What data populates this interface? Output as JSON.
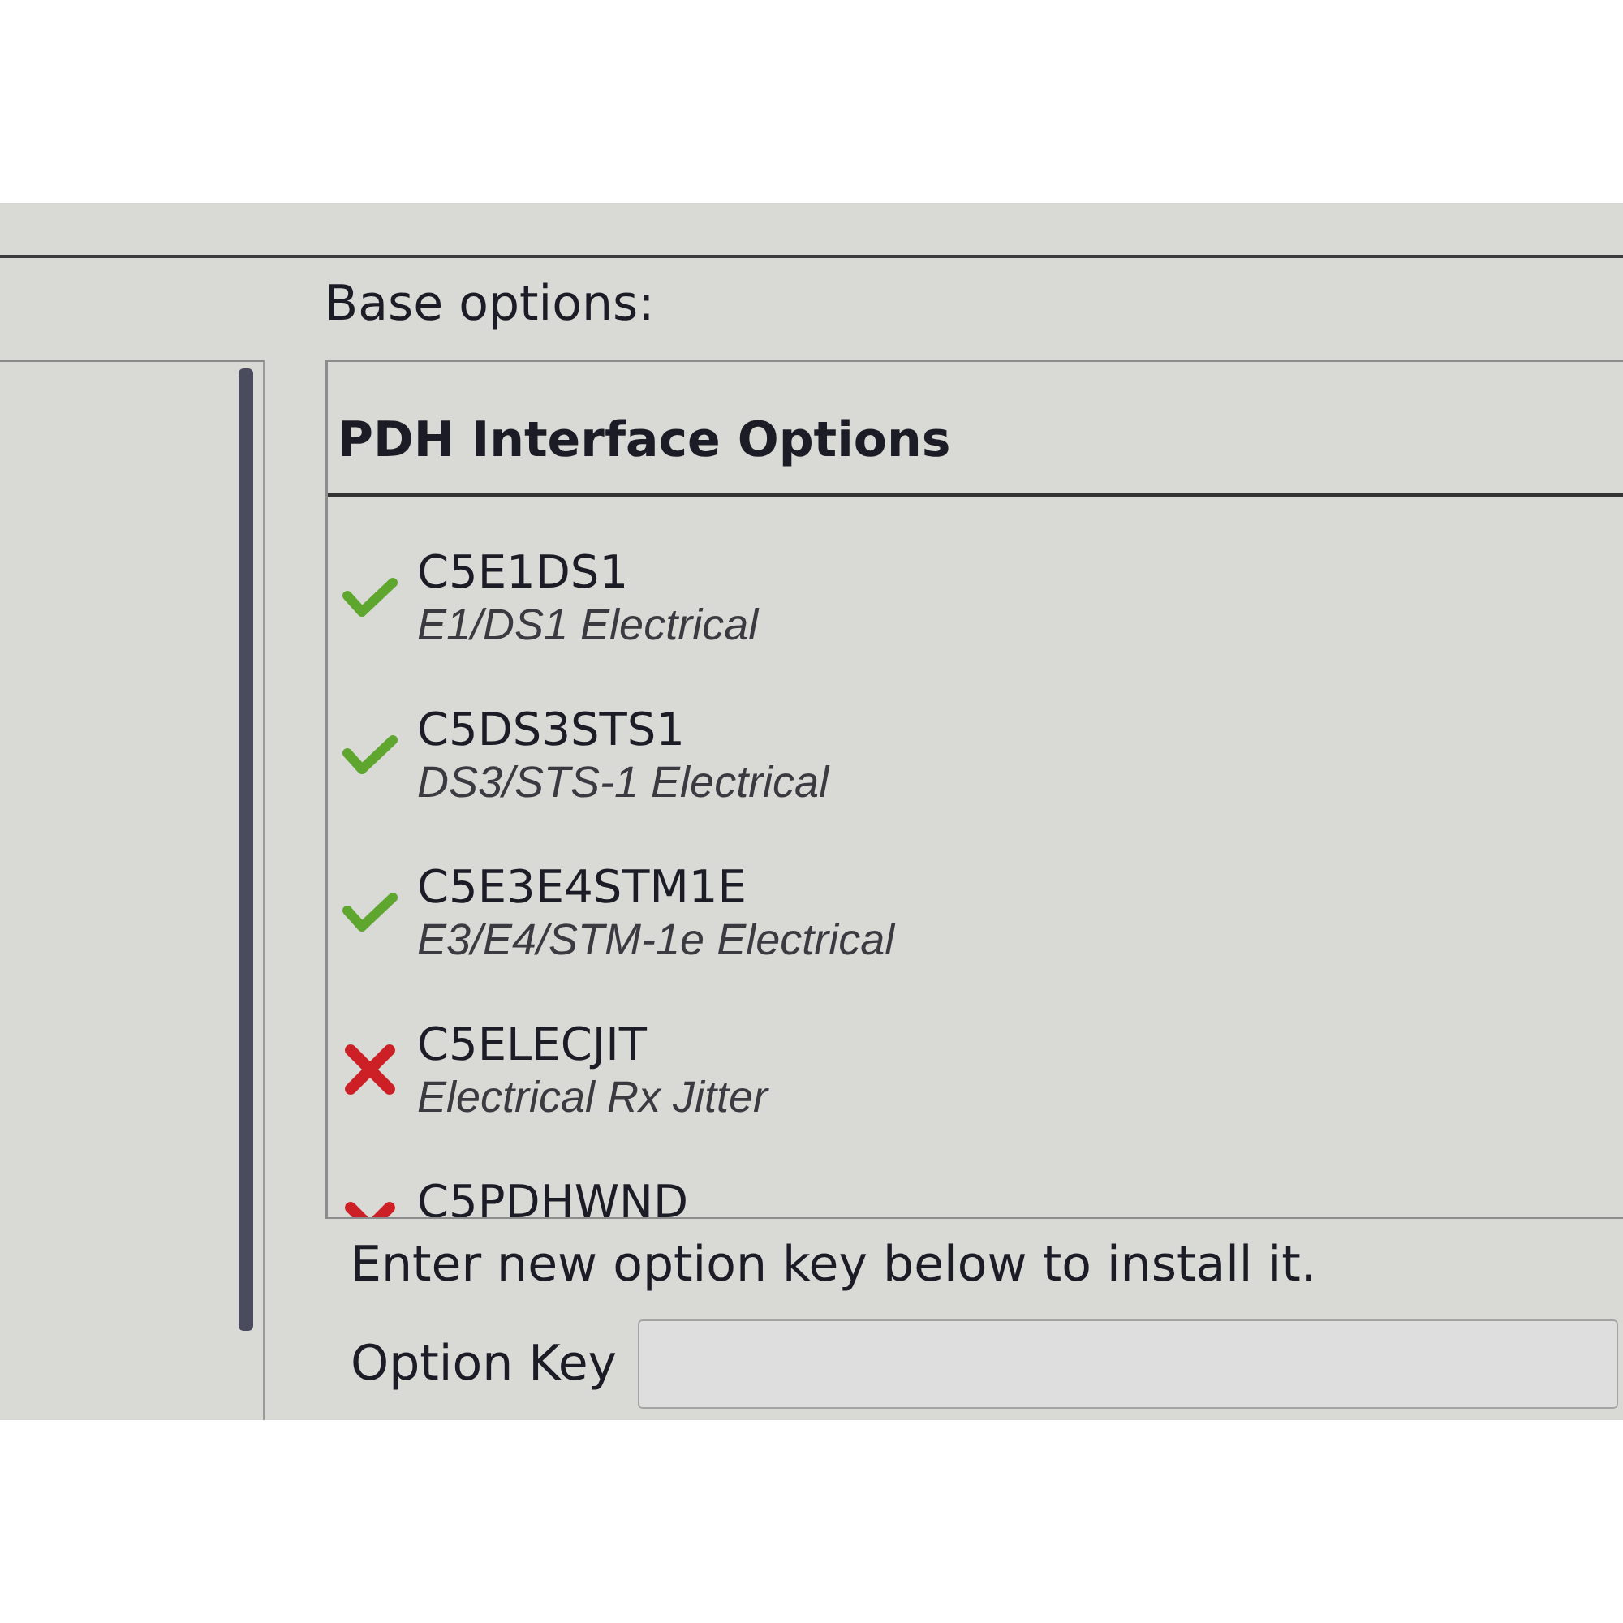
{
  "section_label": "Base options:",
  "group": {
    "title": "PDH Interface Options",
    "options": [
      {
        "code": "C5E1DS1",
        "description": "E1/DS1 Electrical",
        "installed": true
      },
      {
        "code": "C5DS3STS1",
        "description": "DS3/STS-1 Electrical",
        "installed": true
      },
      {
        "code": "C5E3E4STM1E",
        "description": "E3/E4/STM-1e Electrical",
        "installed": true
      },
      {
        "code": "C5ELECJIT",
        "description": "Electrical Rx Jitter",
        "installed": false
      },
      {
        "code": "C5PDHWND",
        "installed": false
      }
    ]
  },
  "instruction": "Enter new option key below to install it.",
  "option_key": {
    "label": "Option Key"
  }
}
